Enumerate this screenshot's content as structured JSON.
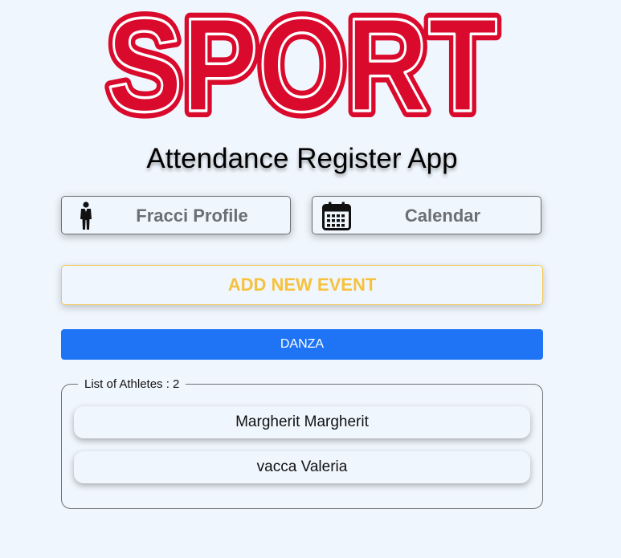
{
  "logo": {
    "text": "SPORT"
  },
  "app_title": "Attendance Register App",
  "nav": {
    "profile_label": "Fracci Profile",
    "profile_icon": "person-icon",
    "calendar_label": "Calendar",
    "calendar_icon": "calendar-icon"
  },
  "add_event_label": "ADD NEW EVENT",
  "event_label": "DANZA",
  "athletes": {
    "legend": "List of Athletes : 2",
    "items": [
      "Margherit Margherit",
      "vacca Valeria"
    ]
  },
  "colors": {
    "background": "#f0f6fd",
    "logo_red": "#d90a2c",
    "add_event_yellow": "#f6c23e",
    "event_blue": "#1e74f5",
    "nav_text_gray": "#6b6f74"
  }
}
